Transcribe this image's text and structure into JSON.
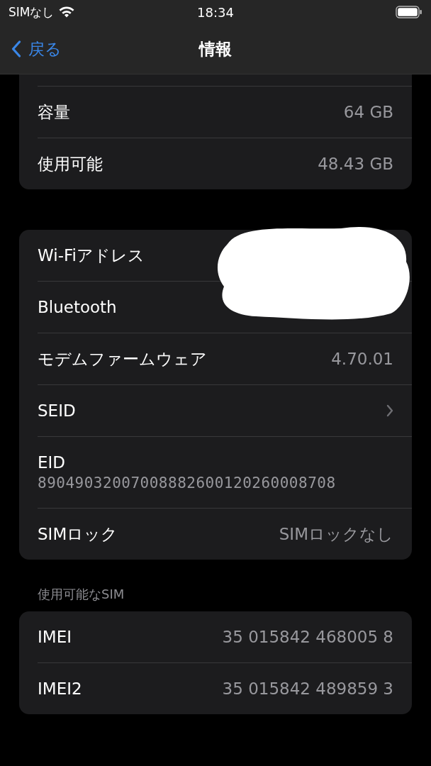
{
  "status_bar": {
    "carrier": "SIMなし",
    "time": "18:34"
  },
  "nav": {
    "back": "戻る",
    "title": "情報"
  },
  "groups": [
    {
      "cut_top": true,
      "redaction": false,
      "rows": [
        {
          "kind": "value",
          "label": "容量",
          "value": "64 GB"
        },
        {
          "kind": "value",
          "label": "使用可能",
          "value": "48.43 GB"
        }
      ]
    },
    {
      "cut_top": false,
      "redaction": true,
      "rows": [
        {
          "kind": "hidden",
          "label": "Wi-Fiアドレス"
        },
        {
          "kind": "hidden",
          "label": "Bluetooth"
        },
        {
          "kind": "value",
          "label": "モデムファームウェア",
          "value": "4.70.01"
        },
        {
          "kind": "link",
          "label": "SEID"
        },
        {
          "kind": "stacked",
          "label": "EID",
          "value": "89049032007008882600120260008708"
        },
        {
          "kind": "value",
          "label": "SIMロック",
          "value": "SIMロックなし"
        }
      ]
    },
    {
      "cut_top": false,
      "redaction": false,
      "header": "使用可能なSIM",
      "rows": [
        {
          "kind": "value",
          "label": "IMEI",
          "value": "35 015842 468005 8"
        },
        {
          "kind": "value",
          "label": "IMEI2",
          "value": "35 015842 489859 3"
        }
      ]
    }
  ]
}
